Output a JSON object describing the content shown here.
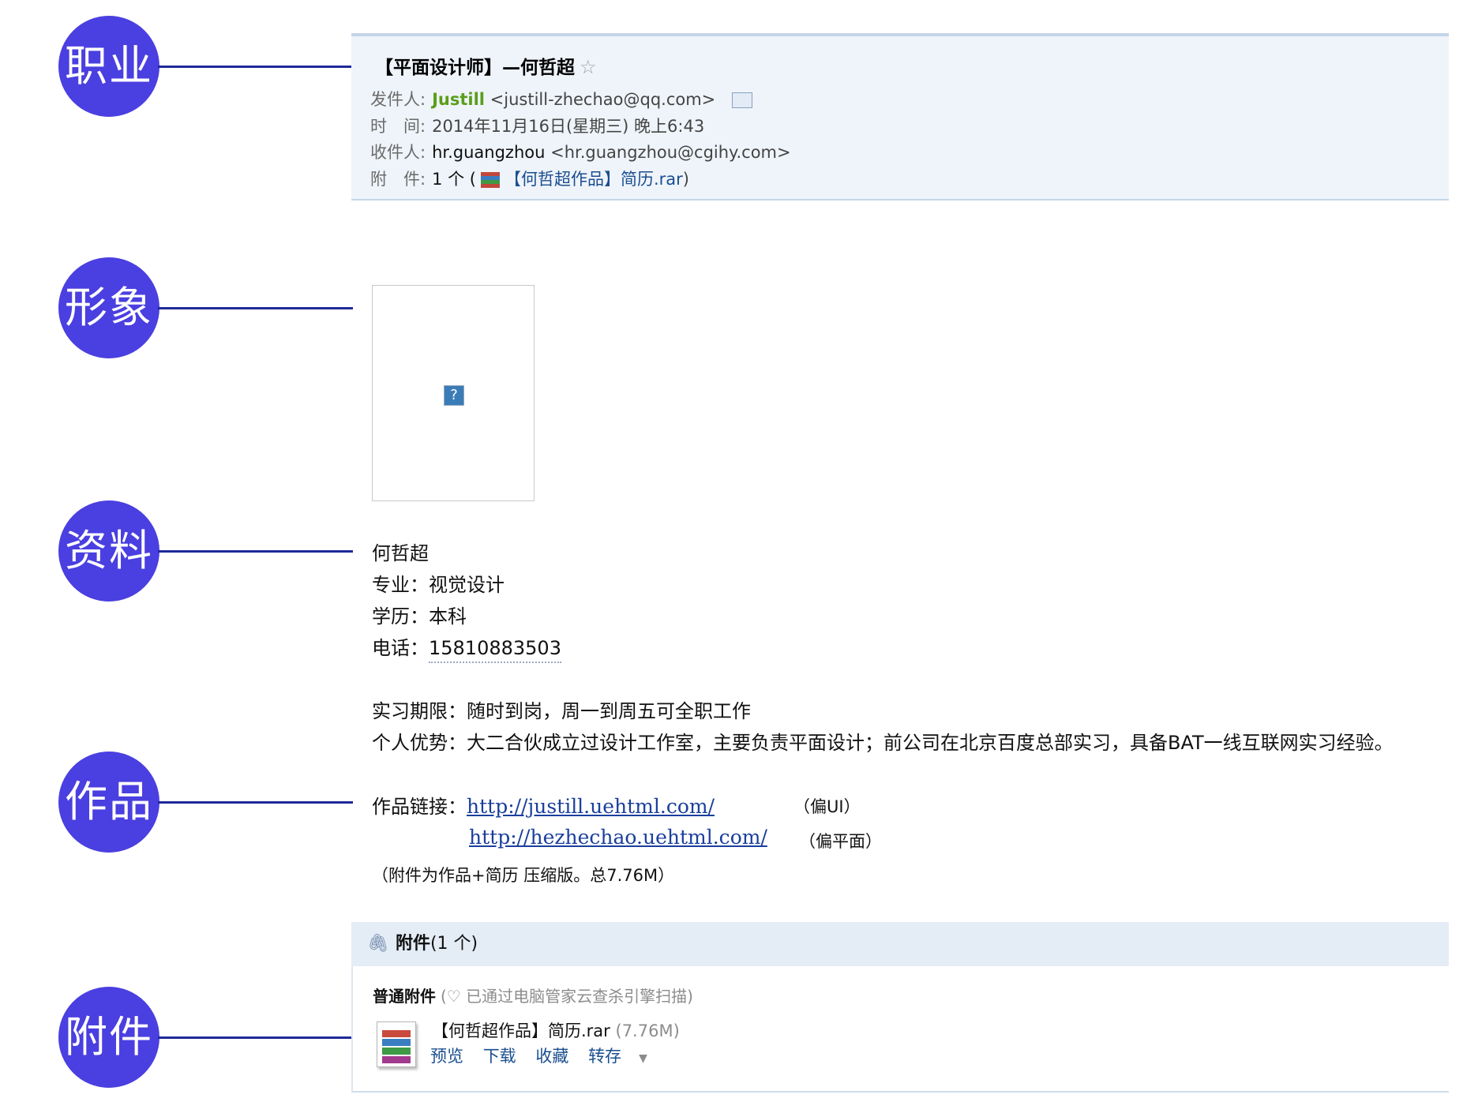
{
  "annotations": {
    "career": "职业",
    "image": "形象",
    "profile": "资料",
    "works": "作品",
    "attachment": "附件"
  },
  "header": {
    "subject": "【平面设计师】—何哲超",
    "star_icon": "☆",
    "from_label": "发件人:",
    "from_name": "Justill",
    "from_email": "<justill-zhechao@qq.com>",
    "time_label": "时　间:",
    "time_value": "2014年11月16日(星期三) 晚上6:43",
    "to_label": "收件人:",
    "to_name": "hr.guangzhou",
    "to_email": "<hr.guangzhou@cgihy.com>",
    "att_label": "附　件:",
    "att_count": "1 个 (",
    "att_name": "【何哲超作品】简历.rar",
    "att_close": ")"
  },
  "photo": {
    "broken_icon": "?"
  },
  "profile": {
    "name": "何哲超",
    "major": "专业：视觉设计",
    "education": "学历：本科",
    "phone_label": "电话：",
    "phone_value": "15810883503",
    "internship": "实习期限：随时到岗，周一到周五可全职工作",
    "advantage": "个人优势：大二合伙成立过设计工作室，主要负责平面设计；前公司在北京百度总部实习，具备BAT一线互联网实习经验。"
  },
  "works": {
    "label": "作品链接：",
    "link1": "http://justill.uehtml.com/",
    "link1_note": "（偏UI）",
    "link2": "http://hezhechao.uehtml.com/",
    "link2_note": "（偏平面）",
    "note": "（附件为作品+简历 压缩版。总7.76M）"
  },
  "attachment_panel": {
    "title": "附件",
    "count": "(1 个)",
    "type_label": "普通附件",
    "scan_text": "(♡ 已通过电脑管家云查杀引擎扫描)",
    "file_name": "【何哲超作品】简历.rar",
    "file_size": "(7.76M)",
    "actions": {
      "preview": "预览",
      "download": "下载",
      "collect": "收藏",
      "save": "转存"
    }
  }
}
